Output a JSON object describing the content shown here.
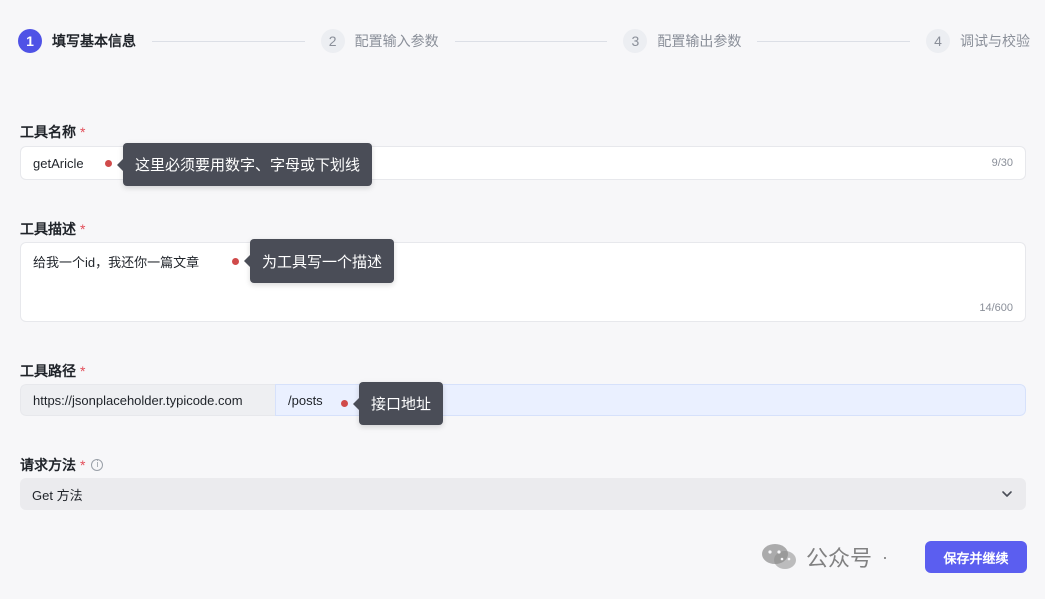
{
  "steps": [
    {
      "num": "1",
      "label": "填写基本信息"
    },
    {
      "num": "2",
      "label": "配置输入参数"
    },
    {
      "num": "3",
      "label": "配置输出参数"
    },
    {
      "num": "4",
      "label": "调试与校验"
    }
  ],
  "active_step": 1,
  "form": {
    "required_mark": "*",
    "tool_name": {
      "label": "工具名称",
      "value": "getAricle",
      "counter": "9/30"
    },
    "tool_desc": {
      "label": "工具描述",
      "value": "给我一个id，我还你一篇文章",
      "counter": "14/600"
    },
    "tool_path": {
      "label": "工具路径",
      "prefix": "https://jsonplaceholder.typicode.com",
      "value": "/posts"
    },
    "method": {
      "label": "请求方法",
      "info_icon": "info-icon",
      "value": "Get 方法"
    }
  },
  "callouts": {
    "name": "这里必须要用数字、字母或下划线",
    "desc": "为工具写一个描述",
    "path": "接口地址"
  },
  "buttons": {
    "save": "保存并继续"
  },
  "watermark": {
    "text": "公众号",
    "separator": "·"
  },
  "colors": {
    "accent": "#4f52e6",
    "button": "#5b5ef0",
    "required": "#e34d59",
    "callout_bg": "#4a4d57",
    "callout_dot": "#d04a4a",
    "path_input_bg": "#eaf0ff"
  }
}
